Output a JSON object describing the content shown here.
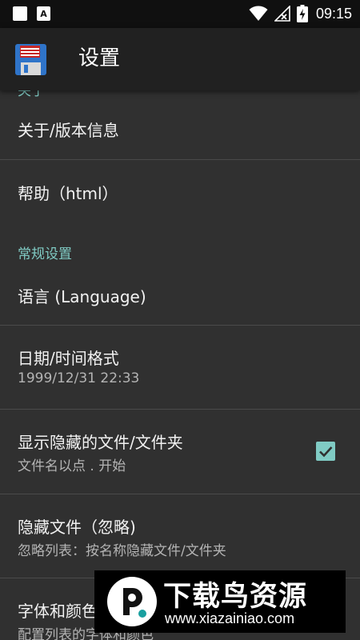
{
  "status_bar": {
    "time": "09:15",
    "icons": [
      "square-notification-icon",
      "a-notification-icon",
      "wifi-icon",
      "no-signal-icon",
      "battery-charging-icon"
    ]
  },
  "app_bar": {
    "title": "设置",
    "icon": "floppy-disk-icon"
  },
  "list": {
    "partial_category": "关于",
    "about": {
      "title": "关于/版本信息"
    },
    "help": {
      "title": "帮助（html）"
    },
    "general_category": "常规设置",
    "language": {
      "title": "语言 (Language)"
    },
    "datetime": {
      "title": "日期/时间格式",
      "subtitle": "1999/12/31  22:33"
    },
    "show_hidden": {
      "title": "显示隐藏的文件/文件夹",
      "subtitle": "文件名以点 . 开始",
      "checked": true
    },
    "hide_files": {
      "title": "隐藏文件（忽略)",
      "subtitle": "忽略列表：按名称隐藏文件/文件夹"
    },
    "fonts": {
      "title": "字体和颜色",
      "subtitle": "配置列表的字体和颜色"
    }
  },
  "watermark": {
    "brand": "下载鸟资源",
    "url": "www.xiazainiao.com"
  },
  "colors": {
    "accent": "#80cbc4",
    "background": "#303030",
    "app_bar": "#212121",
    "status_bar": "#101010"
  }
}
